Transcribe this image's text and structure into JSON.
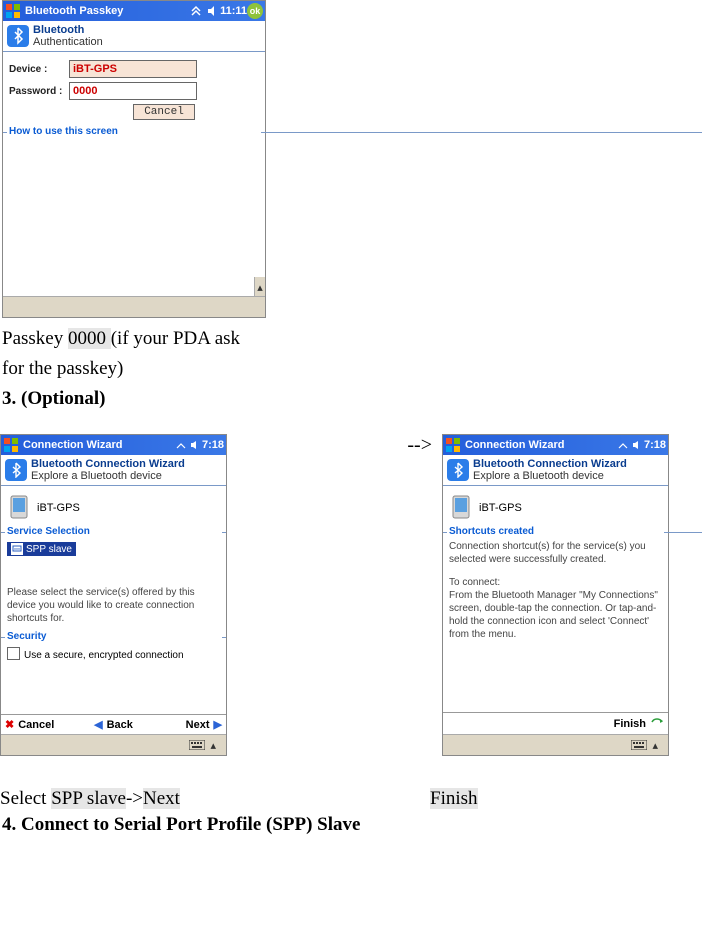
{
  "screen1": {
    "titlebar": {
      "title": "Bluetooth Passkey",
      "time": "11:11",
      "ok": "ok"
    },
    "header": {
      "line1": "Bluetooth",
      "line2": "Authentication"
    },
    "device_label": "Device   :",
    "device_value": "iBT-GPS",
    "password_label": "Password :",
    "password_value": "0000",
    "cancel": "Cancel",
    "howto": "How to use this screen"
  },
  "doc1": {
    "line1a": "Passkey ",
    "line1b_hl": "0000 ",
    "line1c": "(if your PDA ask",
    "line2": "for the passkey)",
    "head3": "3. (Optional)"
  },
  "arrow_text": "-->",
  "screen2": {
    "titlebar": {
      "title": "Connection Wizard",
      "time": "7:18"
    },
    "header": {
      "line1": "Bluetooth Connection Wizard",
      "line2": "Explore a Bluetooth device"
    },
    "device": "iBT-GPS",
    "sec_service": "Service Selection",
    "spp": "SPP slave",
    "note": "Please select the service(s) offered by this device you would like to create connection shortcuts for.",
    "sec_security": "Security",
    "chk_label": "Use a secure, encrypted connection",
    "cancel": "Cancel",
    "back": "Back",
    "next": "Next"
  },
  "screen3": {
    "titlebar": {
      "title": "Connection Wizard",
      "time": "7:18"
    },
    "header": {
      "line1": "Bluetooth Connection Wizard",
      "line2": "Explore a Bluetooth device"
    },
    "device": "iBT-GPS",
    "sec_shortcuts": "Shortcuts created",
    "msg1": "Connection shortcut(s)  for the service(s) you selected were successfully created.",
    "msg2a": "To connect:",
    "msg2b": "From the Bluetooth Manager \"My Connections\" screen, double-tap the connection. Or tap-and-hold the connection icon and select 'Connect' from the menu.",
    "finish": "Finish"
  },
  "caption": {
    "select_a": "Select ",
    "select_b_hl": "SPP slave",
    "select_c": "->",
    "select_d_hl": "Next",
    "finish_hl": "Finish"
  },
  "head4": "4. Connect to Serial Port Profile (SPP) Slave"
}
